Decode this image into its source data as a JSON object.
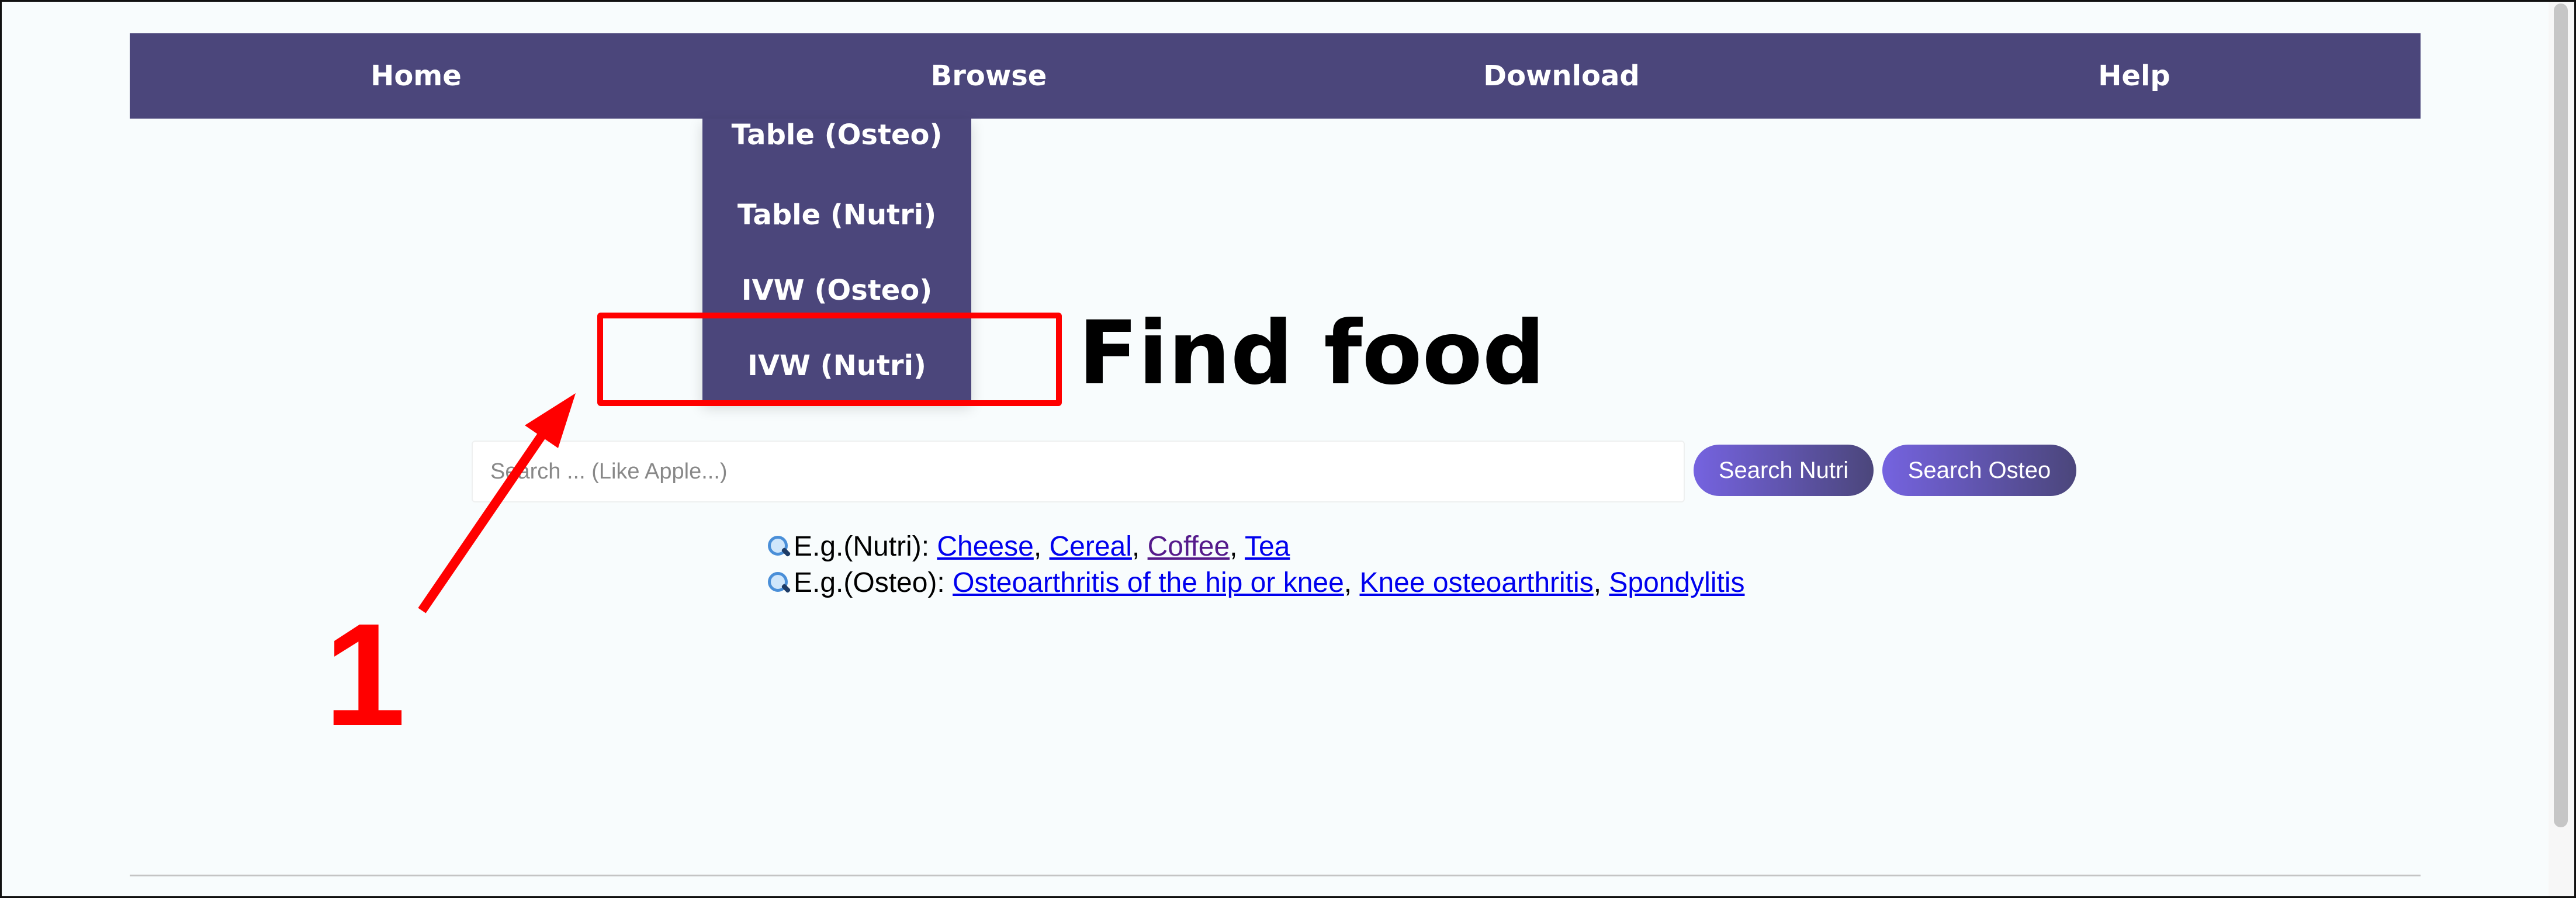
{
  "nav": {
    "items": [
      {
        "label": "Home"
      },
      {
        "label": "Browse"
      },
      {
        "label": "Download"
      },
      {
        "label": "Help"
      }
    ]
  },
  "dropdown": {
    "items": [
      {
        "label": "Table (Osteo)"
      },
      {
        "label": "Table (Nutri)"
      },
      {
        "label": "IVW (Osteo)"
      },
      {
        "label": "IVW (Nutri)"
      }
    ]
  },
  "main": {
    "title": "Find food",
    "search": {
      "placeholder": "Search ... (Like Apple...)",
      "value": ""
    },
    "buttons": {
      "nutri": "Search Nutri",
      "osteo": "Search Osteo"
    },
    "examples": {
      "nutri": {
        "prefix": "E.g.(Nutri):",
        "links": [
          "Cheese",
          "Cereal",
          "Coffee",
          "Tea"
        ]
      },
      "osteo": {
        "prefix": "E.g.(Osteo):",
        "links": [
          "Osteoarthritis of the hip or knee",
          "Knee osteoarthritis",
          "Spondylitis"
        ]
      },
      "separator": ","
    }
  },
  "annotation": {
    "number": "1"
  },
  "colors": {
    "nav_bg": "#4b467b",
    "button_gradient_start": "#7563e0",
    "annotation_red": "#ff0000",
    "link": "#0000ee",
    "link_visited": "#551a8b"
  },
  "icons": {
    "example_marker": "magnifier-icon"
  }
}
